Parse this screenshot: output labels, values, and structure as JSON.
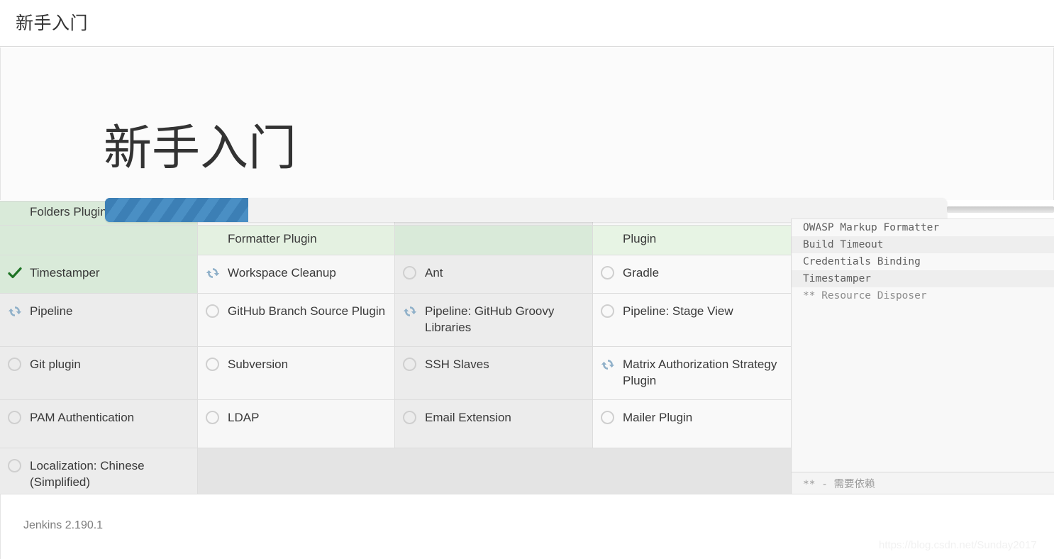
{
  "appbar": {
    "title": "新手入门"
  },
  "hero": {
    "title": "新手入门"
  },
  "progress": {
    "percent": 17,
    "label_hidden": ""
  },
  "grid": {
    "rows": [
      {
        "clipped": true,
        "cells": [
          {
            "label": "Folders Plugin",
            "status": "installed"
          },
          {
            "label": "",
            "status": "none"
          },
          {
            "label": "",
            "status": "none"
          },
          {
            "label": "",
            "status": "none"
          }
        ]
      },
      {
        "header": true,
        "cells": [
          {
            "label": "",
            "status": "installed"
          },
          {
            "label": "Formatter Plugin",
            "status": "installed"
          },
          {
            "label": "",
            "status": "installed"
          },
          {
            "label": "Plugin",
            "status": "installed"
          }
        ]
      },
      {
        "cells": [
          {
            "label": "Timestamper",
            "status": "installed"
          },
          {
            "label": "Workspace Cleanup",
            "status": "installing"
          },
          {
            "label": "Ant",
            "status": "pending"
          },
          {
            "label": "Gradle",
            "status": "pending"
          }
        ]
      },
      {
        "tall": true,
        "cells": [
          {
            "label": "Pipeline",
            "status": "installing"
          },
          {
            "label": "GitHub Branch Source Plugin",
            "status": "pending"
          },
          {
            "label": "Pipeline: GitHub Groovy Libraries",
            "status": "installing"
          },
          {
            "label": "Pipeline: Stage View",
            "status": "pending"
          }
        ]
      },
      {
        "tall": true,
        "cells": [
          {
            "label": "Git plugin",
            "status": "pending"
          },
          {
            "label": "Subversion",
            "status": "pending"
          },
          {
            "label": "SSH Slaves",
            "status": "pending"
          },
          {
            "label": "Matrix Authorization Strategy Plugin",
            "status": "installing"
          }
        ]
      },
      {
        "tall": true,
        "cells": [
          {
            "label": "PAM Authentication",
            "status": "pending"
          },
          {
            "label": "LDAP",
            "status": "pending"
          },
          {
            "label": "Email Extension",
            "status": "pending"
          },
          {
            "label": "Mailer Plugin",
            "status": "pending"
          }
        ]
      },
      {
        "tall": true,
        "cells": [
          {
            "label": "Localization: Chinese (Simplified)",
            "status": "pending"
          },
          {
            "label": "",
            "status": "empty"
          },
          {
            "label": "",
            "status": "empty"
          },
          {
            "label": "",
            "status": "empty"
          }
        ]
      }
    ]
  },
  "log": {
    "lines": [
      {
        "text": "OWASP Markup Formatter",
        "dependency": false
      },
      {
        "text": "Build Timeout",
        "dependency": false
      },
      {
        "text": "Credentials Binding",
        "dependency": false
      },
      {
        "text": "Timestamper",
        "dependency": false
      },
      {
        "text": "** Resource Disposer",
        "dependency": true
      }
    ],
    "footer": "** - 需要依赖"
  },
  "footer": {
    "version": "Jenkins 2.190.1",
    "watermark": "https://blog.csdn.net/Sunday2017"
  },
  "colors": {
    "installed_green": "#d9ead9",
    "check_green": "#1d7324",
    "spinner_blue": "#8fb0c9",
    "progress_blue": "#4a8fc4",
    "progress_blue_dark": "#3c7fb5"
  }
}
